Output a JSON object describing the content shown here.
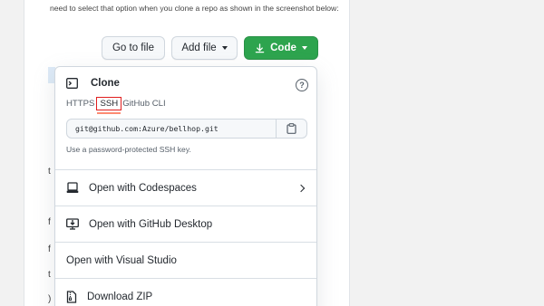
{
  "intro": {
    "text": "need to select that option when you clone a repo as shown in the screenshot below:"
  },
  "toolbar": {
    "goto_file": "Go to file",
    "add_file": "Add file",
    "code": "Code"
  },
  "left_fragments": [
    "t",
    "f",
    "f",
    "t",
    ")"
  ],
  "clone": {
    "title": "Clone",
    "help_icon": "question-icon",
    "tabs": [
      {
        "label": "HTTPS",
        "selected": false
      },
      {
        "label": "SSH",
        "selected": true
      },
      {
        "label": "GitHub CLI",
        "selected": false
      }
    ],
    "url": "git@github.com:Azure/bellhop.git",
    "hint": "Use a password-protected SSH key."
  },
  "menu": [
    {
      "label": "Open with Codespaces",
      "icon": "codespaces-icon",
      "has_submenu": true
    },
    {
      "label": "Open with GitHub Desktop",
      "icon": "desktop-download-icon",
      "has_submenu": false
    },
    {
      "label": "Open with Visual Studio",
      "icon": "",
      "has_submenu": false
    },
    {
      "label": "Download ZIP",
      "icon": "file-zip-icon",
      "has_submenu": false
    }
  ],
  "colors": {
    "code_button": "#2da44e",
    "highlight_box": "#e01e1e",
    "tab_underline": "#fd8c73"
  }
}
